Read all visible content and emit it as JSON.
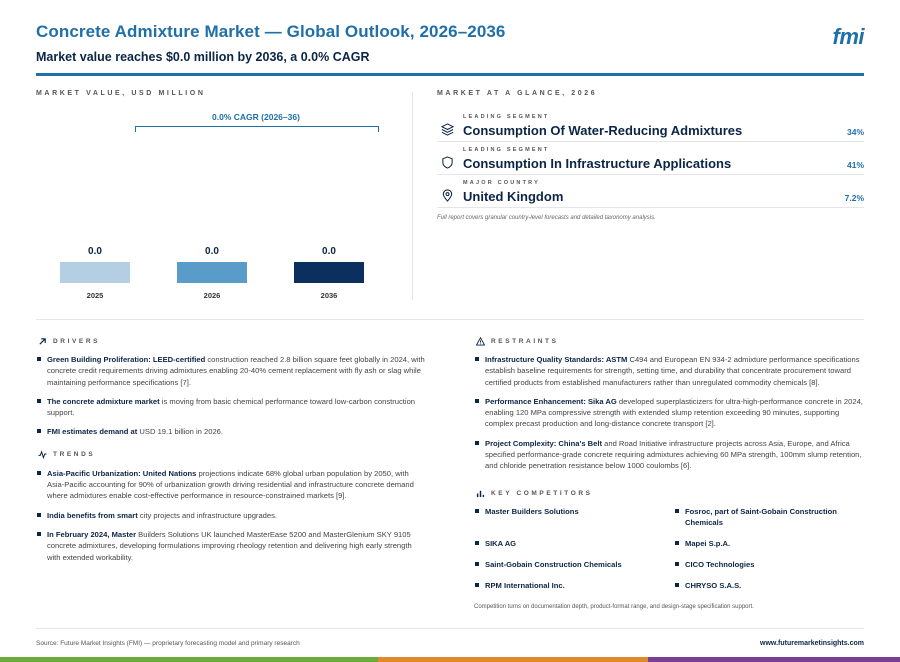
{
  "header": {
    "title": "Concrete Admixture Market — Global Outlook, 2026–2036",
    "subtitle": "Market value reaches $0.0 million by 2036, a 0.0% CAGR",
    "logo": "fmi"
  },
  "market_value": {
    "section_label": "MARKET VALUE, USD MILLION",
    "cagr_label": "0.0% CAGR (2026–36)"
  },
  "chart_data": {
    "type": "bar",
    "categories": [
      "2025",
      "2026",
      "2036"
    ],
    "values": [
      0.0,
      0.0,
      0.0
    ],
    "value_labels": [
      "0.0",
      "0.0",
      "0.0"
    ],
    "colors": [
      "#b4cfe3",
      "#5a9cc9",
      "#0b2f5e"
    ],
    "title": "",
    "xlabel": "",
    "ylabel": ""
  },
  "glance": {
    "section_label": "MARKET AT A GLANCE, 2026",
    "rows": [
      {
        "label": "LEADING SEGMENT",
        "value": "Consumption Of Water-Reducing Admixtures",
        "pct": "34%",
        "icon": "layers-icon"
      },
      {
        "label": "LEADING SEGMENT",
        "value": "Consumption In Infrastructure Applications",
        "pct": "41%",
        "icon": "shield-icon"
      },
      {
        "label": "MAJOR COUNTRY",
        "value": "United Kingdom",
        "pct": "7.2%",
        "icon": "location-pin-icon"
      }
    ],
    "note": "Full report covers granular country-level forecasts and detailed taxonomy analysis."
  },
  "drivers": {
    "label": "DRIVERS",
    "items": [
      {
        "lead": "Green Building Proliferation: LEED-certified",
        "text": " construction reached 2.8 billion square feet globally in 2024, with concrete credit requirements driving admixtures enabling 20-40% cement replacement with fly ash or slag while maintaining performance specifications [7]."
      },
      {
        "lead": "The concrete admixture market",
        "text": " is moving from basic chemical performance toward low-carbon construction support."
      },
      {
        "lead": "FMI estimates demand at",
        "text": " USD 19.1 billion in 2026."
      }
    ]
  },
  "trends": {
    "label": "TRENDS",
    "items": [
      {
        "lead": "Asia-Pacific Urbanization: United Nations",
        "text": " projections indicate 68% global urban population by 2050, with Asia-Pacific accounting for 90% of urbanization growth driving residential and infrastructure concrete demand where admixtures enable cost-effective performance in resource-constrained markets [9]."
      },
      {
        "lead": "India benefits from smart",
        "text": " city projects and infrastructure upgrades."
      },
      {
        "lead": "In February 2024, Master",
        "text": " Builders Solutions UK launched MasterEase 5200 and MasterGlenium SKY 9105 concrete admixtures, developing formulations improving rheology retention and delivering high early strength with extended workability."
      }
    ]
  },
  "restraints": {
    "label": "RESTRAINTS",
    "items": [
      {
        "lead": "Infrastructure Quality Standards: ASTM",
        "text": " C494 and European EN 934-2 admixture performance specifications establish baseline requirements for strength, setting time, and durability that concentrate procurement toward certified products from established manufacturers rather than unregulated commodity chemicals [8]."
      },
      {
        "lead": "Performance Enhancement: Sika AG",
        "text": " developed superplasticizers for ultra-high-performance concrete in 2024, enabling 120 MPa compressive strength with extended slump retention exceeding 90 minutes, supporting complex precast production and long-distance concrete transport [2]."
      },
      {
        "lead": "Project Complexity: China's Belt",
        "text": " and Road Initiative infrastructure projects across Asia, Europe, and Africa specified performance-grade concrete requiring admixtures achieving 60 MPa strength, 100mm slump retention, and chloride penetration resistance below 1000 coulombs [6]."
      }
    ]
  },
  "competitors": {
    "label": "KEY COMPETITORS",
    "items": [
      "Master Builders Solutions",
      "Fosroc, part of Saint-Gobain Construction Chemicals",
      "SIKA AG",
      "Mapei S.p.A.",
      "Saint-Gobain Construction Chemicals",
      "CICO Technologies",
      "RPM International Inc.",
      "CHRYSO S.A.S."
    ],
    "note": "Competition turns on documentation depth, product-format range, and design-stage specification support."
  },
  "footer": {
    "source": "Source: Future Market Insights (FMI) — proprietary forecasting model and primary research",
    "site": "www.futuremarketinsights.com"
  },
  "colors": {
    "primary": "#1f6fa8",
    "navy": "#0b2545",
    "stripe_green": "#6aab3c",
    "stripe_orange": "#e08a2c",
    "stripe_purple": "#7a3e93"
  }
}
